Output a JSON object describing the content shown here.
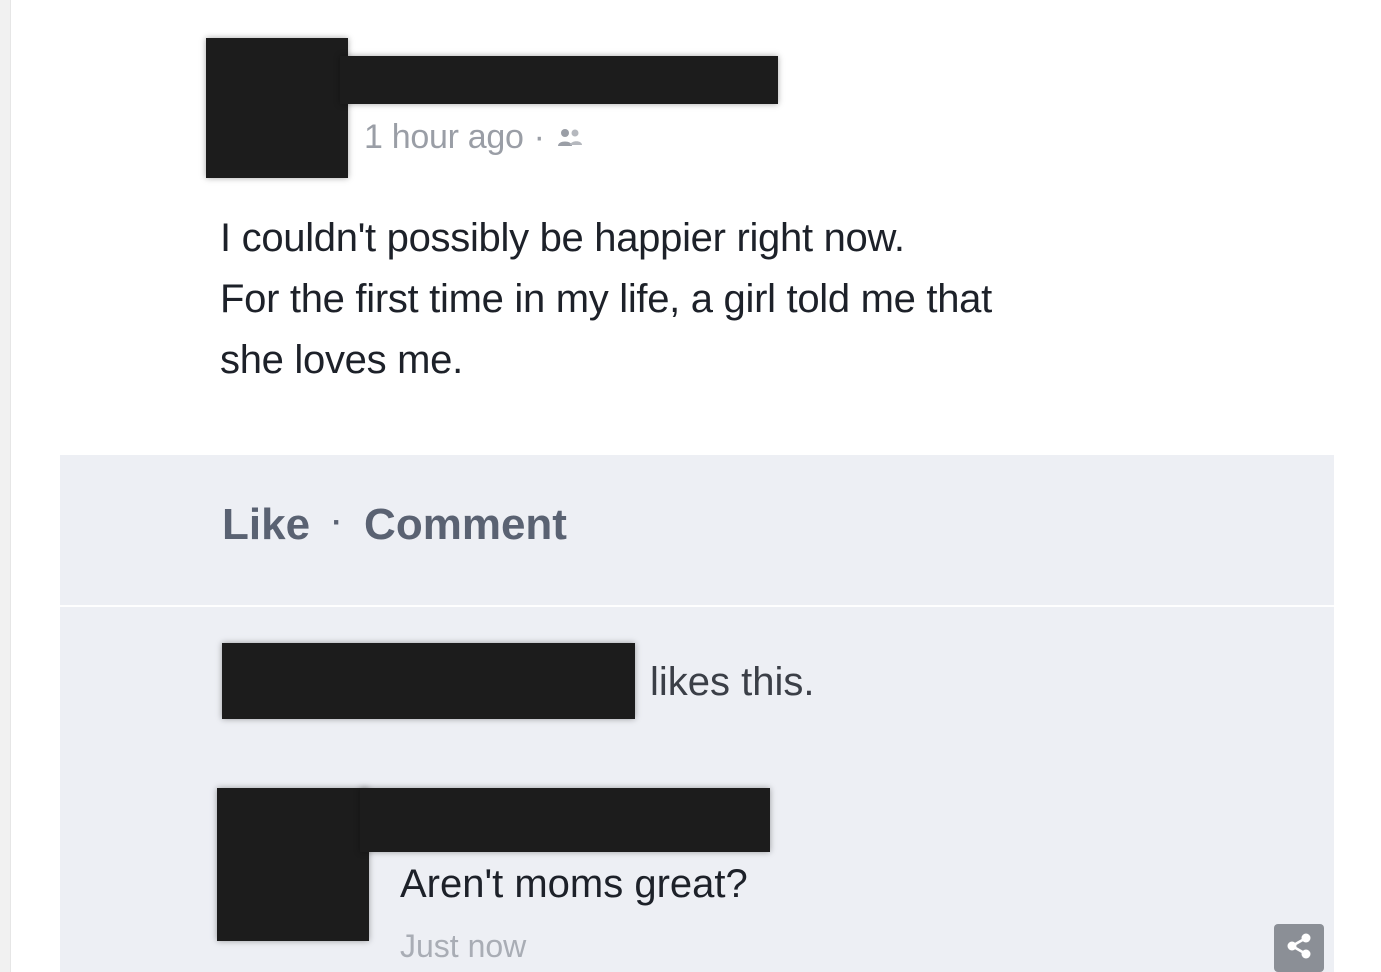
{
  "post": {
    "timestamp": "1 hour ago",
    "separator": "·",
    "audience_icon": "friends-icon",
    "text_lines": [
      "I couldn't possibly be happier right now.",
      "For the first time in my life, a girl told me that",
      "she loves me."
    ]
  },
  "actions": {
    "like_label": "Like",
    "separator": "·",
    "comment_label": "Comment"
  },
  "likes": {
    "suffix": "likes this."
  },
  "comment": {
    "text": "Aren't moms great?",
    "time": "Just now"
  },
  "overlay": {
    "share_icon": "share-icon"
  },
  "colors": {
    "redaction": "#1c1c1c",
    "actions_background": "#edeff4",
    "action_text": "#5a6272",
    "meta_text": "#9a9ea6",
    "share_button": "#8b8f96"
  }
}
